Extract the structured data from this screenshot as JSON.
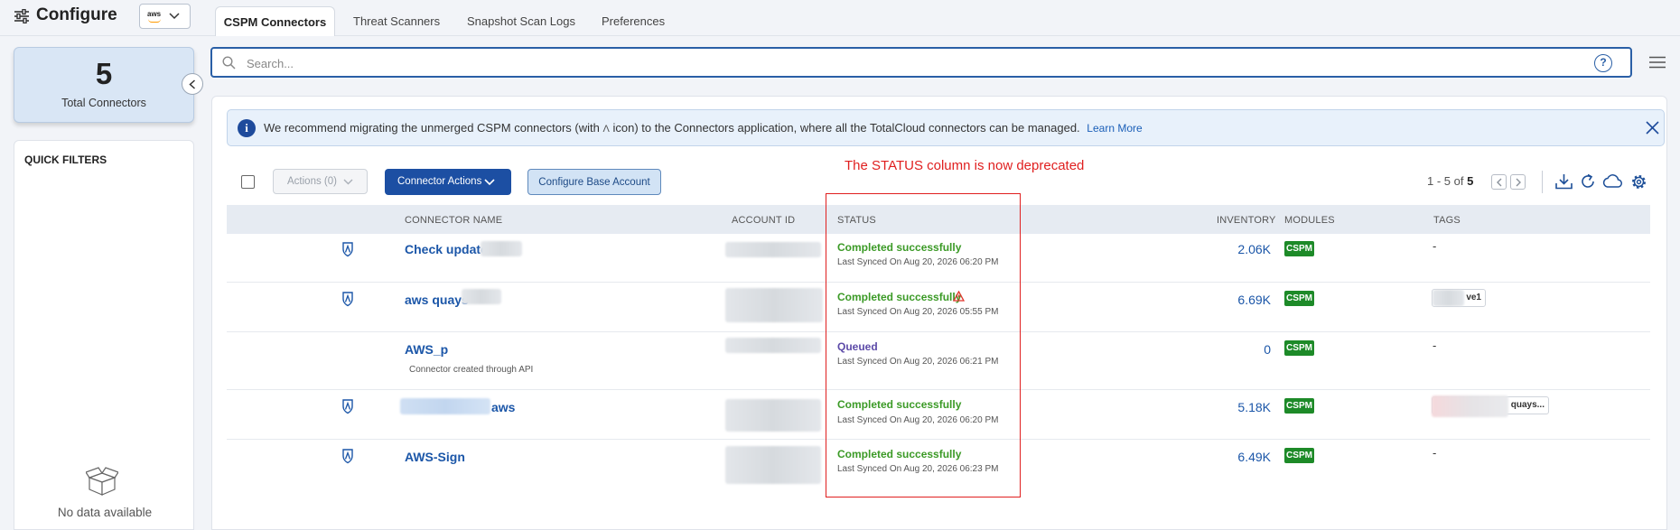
{
  "app": {
    "title": "Configure",
    "cloud_icon": "aws-logo",
    "cloud_logo_text": "aws"
  },
  "tabs": [
    {
      "label": "CSPM Connectors",
      "active": true
    },
    {
      "label": "Threat Scanners",
      "active": false
    },
    {
      "label": "Snapshot Scan Logs",
      "active": false
    },
    {
      "label": "Preferences",
      "active": false
    }
  ],
  "summary": {
    "count": "5",
    "label": "Total Connectors"
  },
  "quick_filters": {
    "title": "QUICK FILTERS",
    "empty_text": "No data available"
  },
  "search": {
    "placeholder": "Search...",
    "help_glyph": "?"
  },
  "banner": {
    "text_before": "We recommend migrating the unmerged CSPM connectors (with",
    "icon_glyph": "Λ",
    "text_after": "icon) to the Connectors application, where all the TotalCloud connectors can be managed.",
    "link": "Learn More",
    "info_glyph": "i"
  },
  "annotation": "The STATUS column is now deprecated",
  "toolbar": {
    "actions_label": "Actions (0)",
    "connector_actions_label": "Connector Actions",
    "configure_base_label": "Configure Base Account"
  },
  "pager": {
    "range": "1 - 5 of",
    "total": "5"
  },
  "columns": {
    "name": "CONNECTOR NAME",
    "account": "ACCOUNT ID",
    "status": "STATUS",
    "inventory": "INVENTORY",
    "modules": "MODULES",
    "tags": "TAGS"
  },
  "rows": [
    {
      "name": "Check update",
      "subtitle": "",
      "status": "Completed successfully",
      "status_color": "#3b9a26",
      "warning": false,
      "synced": "Last Synced On Aug 20, 2026 06:20 PM",
      "inventory": "2.06K",
      "module": "CSPM",
      "tag": "-"
    },
    {
      "name": "aws quays",
      "subtitle": "",
      "status": "Completed successfully",
      "status_color": "#3b9a26",
      "warning": true,
      "synced": "Last Synced On Aug 20, 2026 05:55 PM",
      "inventory": "6.69K",
      "module": "CSPM",
      "tag": "ve1"
    },
    {
      "name": "AWS_p",
      "subtitle": "Connector created through API",
      "status": "Queued",
      "status_color": "#5c4aa8",
      "warning": false,
      "synced": "Last Synced On Aug 20, 2026 06:21 PM",
      "inventory": "0",
      "module": "CSPM",
      "tag": "-"
    },
    {
      "name": "aws",
      "subtitle": "",
      "status": "Completed successfully",
      "status_color": "#3b9a26",
      "warning": false,
      "synced": "Last Synced On Aug 20, 2026 06:20 PM",
      "inventory": "5.18K",
      "module": "CSPM",
      "tag": "quays..."
    },
    {
      "name": "AWS-Sign",
      "subtitle": "",
      "status": "Completed successfully",
      "status_color": "#3b9a26",
      "warning": false,
      "synced": "Last Synced On Aug 20, 2026 06:23 PM",
      "inventory": "6.49K",
      "module": "CSPM",
      "tag": "-"
    }
  ],
  "colors": {
    "accent": "#1c4fa3",
    "link": "#1b56a8",
    "success": "#3b9a26",
    "queued": "#5c4aa8",
    "badge": "#1d8a28",
    "annotation": "#e01f1f"
  }
}
